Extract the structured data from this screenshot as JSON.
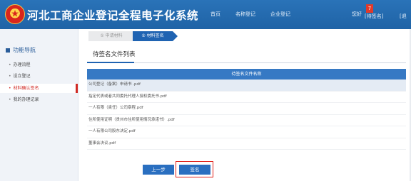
{
  "header": {
    "title": "河北工商企业登记全程电子化系统",
    "nav": [
      "首页",
      "名称登记",
      "企业登记"
    ],
    "greeting": "您好",
    "notify_count": "7",
    "pending_link": "[待签名]",
    "extra_link": "[退"
  },
  "sidebar": {
    "title": "功能导航",
    "items": [
      {
        "label": "办理流程",
        "active": false
      },
      {
        "label": "设立登记",
        "active": false
      },
      {
        "label": "材料确认签名",
        "active": true
      },
      {
        "label": "我的办理记录",
        "active": false
      }
    ]
  },
  "steps": [
    {
      "label": "① 申请材料"
    },
    {
      "label": "② 材料签名"
    }
  ],
  "main": {
    "section_title": "待签名文件列表",
    "table_header": "待签名文件名称",
    "files": [
      "公司登记（备案）申请书 .pdf",
      "指定代表或者共同委托代理人授权委托书.pdf",
      "一人有限（責任）公司章程.pdf",
      "住所使用证明（贵州市住所使用情况承诺书）.pdf",
      "一人有限公司股东决定.pdf",
      "董事会决议.pdf"
    ],
    "prev_button": "上一步",
    "sign_button": "签名"
  },
  "colors": {
    "header_bg": "#1f63a6",
    "accent": "#1f63b2",
    "active_menu": "#d12a24",
    "highlight_border": "#e0231c"
  },
  "icons": {
    "emblem": "national-emblem-icon"
  }
}
